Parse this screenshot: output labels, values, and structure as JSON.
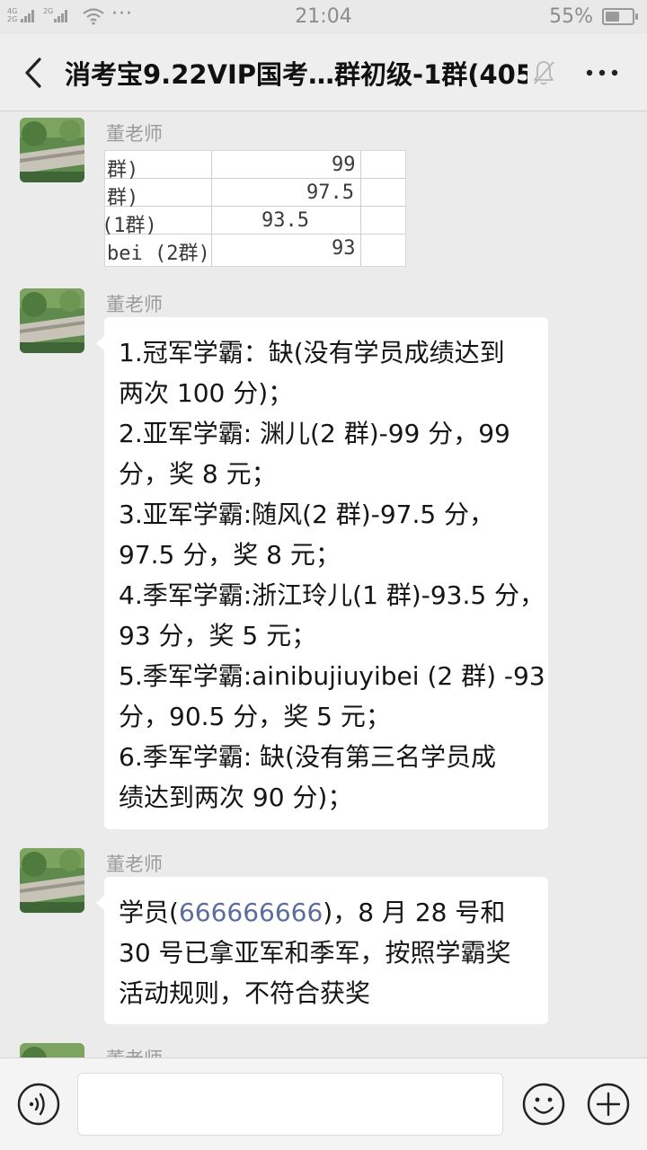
{
  "status_bar": {
    "signal_1": "4G",
    "signal_2": "2G",
    "signal_3": "2G",
    "more": "···",
    "time": "21:04",
    "battery": "55%",
    "battery_level": 0.55
  },
  "header": {
    "title": "消考宝9.22VIP国考…群初级-1群(405)"
  },
  "messages": [
    {
      "sender": "董老师",
      "image_table": {
        "rows": [
          [
            "群)",
            "",
            "99"
          ],
          [
            "群)",
            "",
            "97.5"
          ],
          [
            "(1群)",
            "93.5",
            ""
          ],
          [
            "bei (2群)",
            "",
            "93"
          ]
        ]
      }
    },
    {
      "sender": "董老师",
      "lines": [
        "1.冠军学霸：缺(没有学员成绩达到",
        "两次 100 分)；",
        "2.亚军学霸: 渊儿(2 群)-99 分，99",
        "分，奖 8 元；",
        "3.亚军学霸:随风(2 群)-97.5 分，",
        "97.5 分，奖 8 元；",
        "4.季军学霸:浙江玲儿(1 群)-93.5 分，",
        "93 分，奖 5 元；",
        "5.季军学霸:ainibujiuyibei (2 群) -93",
        "分，90.5 分，奖 5 元；",
        "6.季军学霸: 缺(没有第三名学员成",
        "绩达到两次 90 分)；"
      ]
    },
    {
      "sender": "董老师",
      "line1_prefix": "学员(",
      "line1_link": "666666666",
      "line1_suffix": ")，8 月 28 号和",
      "line2": "30 号已拿亚军和季军，按照学霸奖",
      "line3": "活动规则，不符合获奖"
    },
    {
      "sender": "董老师"
    }
  ],
  "input_bar": {
    "placeholder": ""
  },
  "colors": {
    "link": "#5b6d9c",
    "background": "#ebebeb",
    "bubble": "#ffffff"
  },
  "icons": [
    "back-icon",
    "mute-bell-icon",
    "more-icon",
    "voice-icon",
    "emoji-icon",
    "plus-icon"
  ]
}
